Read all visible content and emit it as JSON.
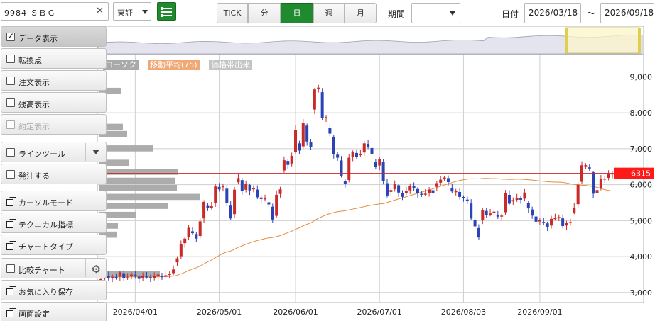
{
  "toolbar": {
    "symbol": "9984 ＳＢＧ",
    "clear_glyph": "✕",
    "market": "東証",
    "timeframes": [
      {
        "label": "TICK",
        "active": false
      },
      {
        "label": "分",
        "active": false
      },
      {
        "label": "日",
        "active": true
      },
      {
        "label": "週",
        "active": false
      },
      {
        "label": "月",
        "active": false
      }
    ],
    "period_label": "期間",
    "period_value": "",
    "date_label": "日付",
    "date_from": "2026/03/18",
    "date_sep": "～",
    "date_to": "2026/09/18"
  },
  "sidebar": {
    "items": [
      {
        "label": "データ表示",
        "type": "checkbox",
        "checked": true,
        "active": true
      },
      {
        "label": "転換点",
        "type": "checkbox",
        "checked": false
      },
      {
        "label": "注文表示",
        "type": "checkbox",
        "checked": false
      },
      {
        "label": "残高表示",
        "type": "checkbox",
        "checked": false
      },
      {
        "label": "約定表示",
        "type": "checkbox",
        "checked": false,
        "disabled": true
      },
      {
        "label": "ラインツール",
        "type": "checkbox",
        "checked": false,
        "extra": "dropdown"
      },
      {
        "label": "発注する",
        "type": "checkbox",
        "checked": false
      },
      {
        "label": "カーソルモード",
        "type": "window"
      },
      {
        "label": "テクニカル指標",
        "type": "window"
      },
      {
        "label": "チャートタイプ",
        "type": "window"
      },
      {
        "label": "比較チャート",
        "type": "checkbox",
        "checked": false,
        "extra": "gear"
      },
      {
        "label": "お気に入り保存",
        "type": "window"
      },
      {
        "label": "画面設定",
        "type": "window"
      }
    ]
  },
  "legend": [
    {
      "label": "ローソク",
      "color": "#a9a9a9"
    },
    {
      "label": "移動平均(75)",
      "color": "#f0a875"
    },
    {
      "label": "価格帯出来",
      "color": "#c4c4c4"
    }
  ],
  "colors": {
    "up": "#c92a2a",
    "down": "#2a44b8",
    "ma": "#e88a3c",
    "last_price_line": "#c92a2a",
    "last_price_bg": "#ff1a1a",
    "volume_profile": "#a8a8a8",
    "grid": "#cfcfcf",
    "accent_green": "#1f8a2e"
  },
  "chart_data": {
    "type": "candlestick",
    "y_ticks": [
      "9,000",
      "8,000",
      "7,000",
      "6,000",
      "5,000",
      "4,000",
      "3,000"
    ],
    "y_tick_values": [
      9000,
      8000,
      7000,
      6000,
      5000,
      4000,
      3000
    ],
    "ylim": [
      2720,
      9620
    ],
    "x_tick_labels": [
      "2026/04/01",
      "2026/05/01",
      "2026/06/01",
      "2026/07/01",
      "2026/08/03",
      "2026/09/01"
    ],
    "last_price": 6315,
    "last_price_label": "6315",
    "ma_period": 75,
    "closes": [
      3370,
      3480,
      3390,
      3440,
      3430,
      3560,
      3400,
      3420,
      3500,
      3450,
      3380,
      3470,
      3430,
      3390,
      3450,
      3500,
      3430,
      3480,
      3520,
      3640,
      3950,
      4350,
      4500,
      4800,
      4650,
      4500,
      4980,
      5520,
      5350,
      5400,
      5950,
      5870,
      5960,
      5480,
      5060,
      5860,
      6180,
      5830,
      6020,
      5840,
      5900,
      5650,
      5600,
      5620,
      5450,
      5030,
      5720,
      5870,
      6680,
      6550,
      6800,
      7520,
      6950,
      7720,
      7200,
      7050,
      8650,
      8700,
      7850,
      7880,
      7420,
      6850,
      6750,
      6250,
      6020,
      6750,
      6900,
      6780,
      6850,
      7150,
      7050,
      6850,
      6500,
      6720,
      6100,
      5700,
      5850,
      6020,
      5780,
      5660,
      5820,
      5970,
      5900,
      5760,
      5740,
      5750,
      5860,
      5760,
      6040,
      6140,
      6200,
      6070,
      5810,
      5820,
      5660,
      5650,
      5550,
      5060,
      4840,
      4530,
      5290,
      5160,
      5200,
      5250,
      5110,
      5140,
      5760,
      5470,
      5570,
      5630,
      5580,
      5780,
      5340,
      5140,
      4970,
      5010,
      4940,
      4830,
      5050,
      5070,
      5100,
      4850,
      4940,
      4960,
      5360,
      6000,
      6540,
      6540,
      6450,
      5750,
      5850,
      6150,
      6170,
      6300,
      6315
    ],
    "volume_profile": [
      {
        "price": 8600,
        "volume": 32
      },
      {
        "price": 7800,
        "volume": 12
      },
      {
        "price": 7600,
        "volume": 34
      },
      {
        "price": 7400,
        "volume": 40
      },
      {
        "price": 7000,
        "volume": 77
      },
      {
        "price": 6600,
        "volume": 42
      },
      {
        "price": 6350,
        "volume": 112
      },
      {
        "price": 6100,
        "volume": 107
      },
      {
        "price": 5900,
        "volume": 110
      },
      {
        "price": 5650,
        "volume": 143
      },
      {
        "price": 5400,
        "volume": 97
      },
      {
        "price": 5150,
        "volume": 52
      },
      {
        "price": 4850,
        "volume": 27
      },
      {
        "price": 4600,
        "volume": 25
      },
      {
        "price": 3500,
        "volume": 86
      }
    ]
  }
}
